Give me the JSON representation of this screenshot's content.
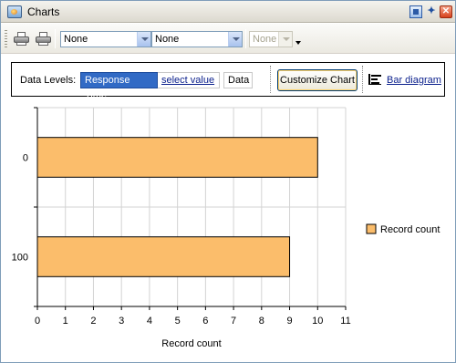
{
  "window": {
    "title": "Charts",
    "icons": [
      "charts-app-icon",
      "window-menu-icon",
      "pin-icon",
      "close-icon"
    ]
  },
  "toolbar": {
    "print_icon": "printer-icon",
    "print_preview_icon": "print-preview-icon",
    "combo1": "None",
    "combo2": "None",
    "combo3": "None"
  },
  "panel": {
    "data_levels_label": "Data Levels:",
    "response_time": "Response Time",
    "select_value": "select value",
    "data": "Data",
    "customize_chart": "Customize Chart",
    "bar_diagram": "Bar diagram"
  },
  "colors": {
    "bar_fill": "#fbbd6b",
    "selected_chip": "#316ac5",
    "link": "#0a1f8c"
  },
  "chart_data": {
    "type": "bar",
    "orientation": "horizontal",
    "categories": [
      "0",
      "100"
    ],
    "series": [
      {
        "name": "Record count",
        "values": [
          10,
          9
        ]
      }
    ],
    "xlabel": "Record count",
    "xlim": [
      0,
      11
    ],
    "xticks": [
      "0",
      "1",
      "2",
      "3",
      "4",
      "5",
      "6",
      "7",
      "8",
      "9",
      "10",
      "11"
    ],
    "grid": true,
    "legend_position": "right"
  }
}
